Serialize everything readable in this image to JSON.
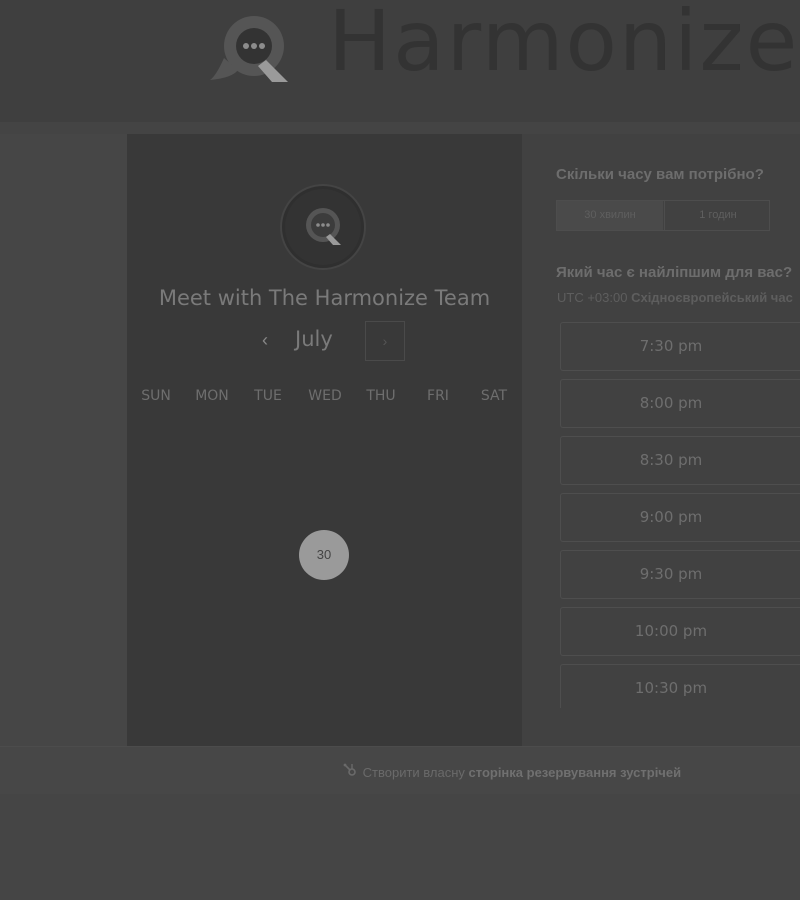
{
  "brand": {
    "name": "Harmonize"
  },
  "calendar": {
    "title": "Meet with The Harmonize Team",
    "month": "July",
    "prev_icon": "‹",
    "next_icon": "›",
    "weekdays": [
      "SUN",
      "MON",
      "TUE",
      "WED",
      "THU",
      "FRI",
      "SAT"
    ],
    "days": [
      "30"
    ]
  },
  "booking": {
    "duration_question": "Скільки часу вам потрібно?",
    "durations": [
      "30 хвилин",
      "1 годин"
    ],
    "time_question": "Який час є найліпшим для вас?",
    "timezone_offset": "UTC +03:00",
    "timezone_name": "Східноєвропейський час",
    "slots": [
      "7:30 pm",
      "8:00 pm",
      "8:30 pm",
      "9:00 pm",
      "9:30 pm",
      "10:00 pm",
      "10:30 pm"
    ]
  },
  "footer": {
    "icon": "sprocket-icon",
    "text": "Створити власну",
    "link": "сторінка резервування зустрічей"
  },
  "colors": {
    "overlay": "#444444",
    "selected_day": "#9a9a9a"
  }
}
